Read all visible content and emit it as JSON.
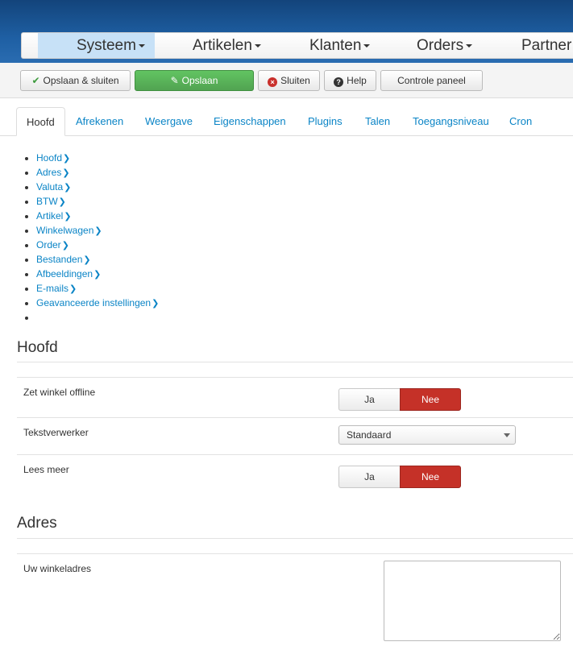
{
  "menu": {
    "items": [
      {
        "label": "Systeem"
      },
      {
        "label": "Artikelen"
      },
      {
        "label": "Klanten"
      },
      {
        "label": "Orders"
      },
      {
        "label": "Partner"
      }
    ]
  },
  "toolbar": {
    "save_close_label": "Opslaan & sluiten",
    "save_label": "Opslaan",
    "close_label": "Sluiten",
    "help_label": "Help",
    "control_panel_label": "Controle paneel"
  },
  "tabs": [
    {
      "label": "Hoofd"
    },
    {
      "label": "Afrekenen"
    },
    {
      "label": "Weergave"
    },
    {
      "label": "Eigenschappen"
    },
    {
      "label": "Plugins"
    },
    {
      "label": "Talen"
    },
    {
      "label": "Toegangsniveau"
    },
    {
      "label": "Cron"
    }
  ],
  "section_links": [
    {
      "label": "Hoofd"
    },
    {
      "label": "Adres"
    },
    {
      "label": "Valuta"
    },
    {
      "label": "BTW"
    },
    {
      "label": "Artikel"
    },
    {
      "label": "Winkelwagen"
    },
    {
      "label": "Order"
    },
    {
      "label": "Bestanden"
    },
    {
      "label": "Afbeeldingen"
    },
    {
      "label": "E-mails"
    },
    {
      "label": "Geavanceerde instellingen"
    }
  ],
  "main_section": {
    "title": "Hoofd",
    "offline_label": "Zet winkel offline",
    "editor_label": "Tekstverwerker",
    "editor_value": "Standaard",
    "readmore_label": "Lees meer",
    "yes_label": "Ja",
    "no_label": "Nee"
  },
  "address_section": {
    "title": "Adres",
    "store_address_label": "Uw winkeladres",
    "store_address_value": ""
  },
  "colors": {
    "header_blue": "#1e5fa3",
    "active_menu": "#c7e1f7",
    "save_green": "#51a351",
    "toggle_red": "#c53128",
    "link_blue": "#0a84c6"
  }
}
